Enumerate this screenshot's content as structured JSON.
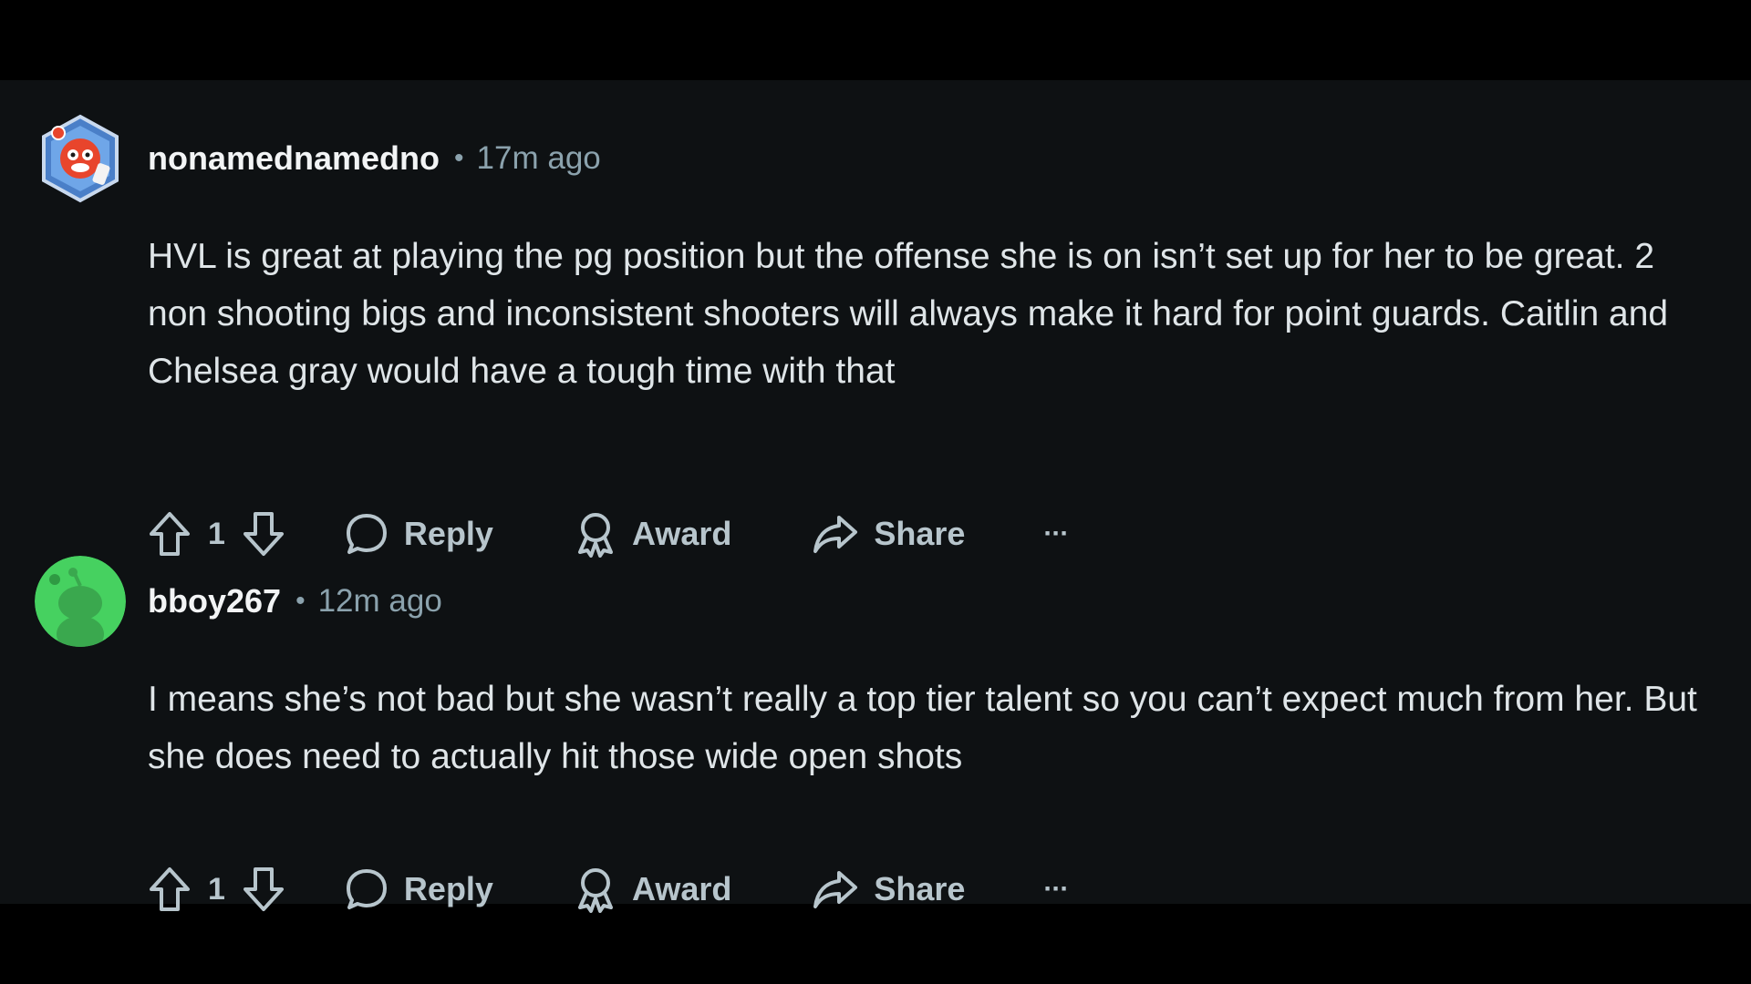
{
  "colors": {
    "background": "#0e1113",
    "username": "#f2f4f5",
    "meta": "#8ba2ad",
    "body_text": "#dfe5e8",
    "action": "#b7c5cc",
    "avatar1_bg": "#5a8fd8",
    "avatar1_face": "#e8452c",
    "avatar2_bg": "#46d160",
    "avatar2_snoo": "#3aa84e"
  },
  "comments": [
    {
      "username": "nonamednamedno",
      "separator": "•",
      "time": "17m ago",
      "avatar_icon": "snoo-avatar-icon",
      "body": "HVL is great at playing the pg position but the offense she is on isn’t set up for her to be great. 2 non shooting bigs and inconsistent shooters will always make it hard for point guards. Caitlin and Chelsea gray would have a tough time with that",
      "votes": "1",
      "actions": {
        "reply": "Reply",
        "award": "Award",
        "share": "Share",
        "more": "···"
      }
    },
    {
      "username": "bboy267",
      "separator": "•",
      "time": "12m ago",
      "avatar_icon": "default-snoo-avatar-icon",
      "body": "I means she’s not bad but she wasn’t really a top tier talent so you can’t expect much from her. But she does need to actually hit those wide open shots",
      "votes": "1",
      "actions": {
        "reply": "Reply",
        "award": "Award",
        "share": "Share",
        "more": "···"
      }
    }
  ]
}
